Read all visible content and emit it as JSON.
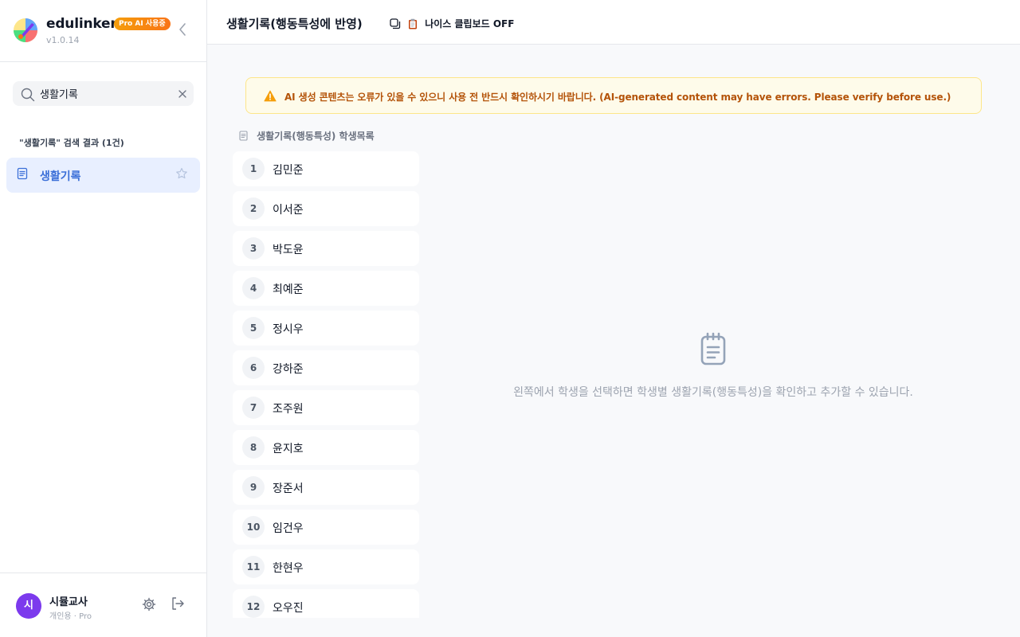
{
  "sidebar": {
    "brand_name": "edulinker",
    "badge": "Pro AI 사용중",
    "version": "v1.0.14",
    "search_value": "생활기록",
    "result_heading": "\"생활기록\" 검색 결과 (1건)",
    "active_item": {
      "label": "생활기록",
      "icon": "document-icon"
    },
    "user": {
      "avatar_initial": "시",
      "name": "시뮬교사",
      "plan": "개인용 · Pro"
    }
  },
  "header": {
    "title": "생활기록(행동특성에 반영)",
    "clipboard_label": "나이스 클립보드 OFF"
  },
  "warning": {
    "text": "AI 생성 콘텐츠는 오류가 있을 수 있으니 사용 전 반드시 확인하시기 바랍니다. (AI-generated content may have errors. Please verify before use.)"
  },
  "student_list": {
    "heading": "생활기록(행동특성) 학생목록",
    "students": [
      {
        "num": "1",
        "name": "김민준"
      },
      {
        "num": "2",
        "name": "이서준"
      },
      {
        "num": "3",
        "name": "박도윤"
      },
      {
        "num": "4",
        "name": "최예준"
      },
      {
        "num": "5",
        "name": "정시우"
      },
      {
        "num": "6",
        "name": "강하준"
      },
      {
        "num": "7",
        "name": "조주원"
      },
      {
        "num": "8",
        "name": "윤지호"
      },
      {
        "num": "9",
        "name": "장준서"
      },
      {
        "num": "10",
        "name": "임건우"
      },
      {
        "num": "11",
        "name": "한현우"
      },
      {
        "num": "12",
        "name": "오우진"
      }
    ]
  },
  "empty_state": {
    "text": "왼쪽에서 학생을 선택하면 학생별 생활기록(행동특성)을 확인하고 추가할 수 있습니다."
  },
  "colors": {
    "accent": "#3b6fd8",
    "active_bg": "#e8efff",
    "warning_text": "#b45309",
    "warning_bg": "#fefbea",
    "avatar": "#7c3aed"
  }
}
